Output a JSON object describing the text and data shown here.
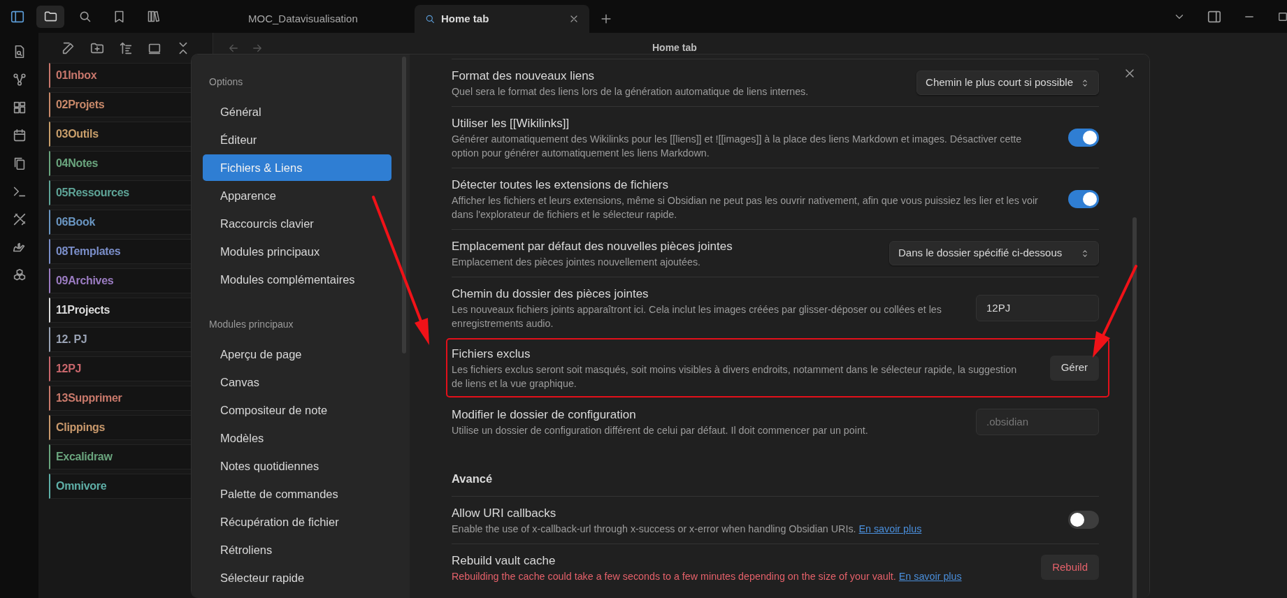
{
  "tabs": [
    {
      "label": "MOC_Datavisualisation",
      "selected": false
    },
    {
      "label": "Home tab",
      "selected": true
    }
  ],
  "view_header": {
    "title": "Home tab"
  },
  "file_explorer": {
    "folders": [
      {
        "name": "01Inbox",
        "color": "#c8776c"
      },
      {
        "name": "02Projets",
        "color": "#c9896a"
      },
      {
        "name": "03Outils",
        "color": "#c99f6b"
      },
      {
        "name": "04Notes",
        "color": "#6aa57e"
      },
      {
        "name": "05Ressources",
        "color": "#5fa598"
      },
      {
        "name": "06Book",
        "color": "#6a96c2"
      },
      {
        "name": "08Templates",
        "color": "#7b8fca"
      },
      {
        "name": "09Archives",
        "color": "#9b7cc2"
      },
      {
        "name": "11Projects",
        "color": "#dcdcdc"
      },
      {
        "name": "12. PJ",
        "color": "#9aa3b5"
      },
      {
        "name": "12PJ",
        "color": "#c9676c"
      },
      {
        "name": "13Supprimer",
        "color": "#c9796b"
      },
      {
        "name": "Clippings",
        "color": "#c9996c"
      },
      {
        "name": "Excalidraw",
        "color": "#6aa57e"
      },
      {
        "name": "Omnivore",
        "color": "#5fb0a8"
      }
    ]
  },
  "settings": {
    "nav": [
      {
        "heading": "Options",
        "items": [
          {
            "label": "Général",
            "selected": false
          },
          {
            "label": "Éditeur",
            "selected": false
          },
          {
            "label": "Fichiers & Liens",
            "selected": true
          },
          {
            "label": "Apparence",
            "selected": false
          },
          {
            "label": "Raccourcis clavier",
            "selected": false
          },
          {
            "label": "Modules principaux",
            "selected": false
          },
          {
            "label": "Modules complémentaires",
            "selected": false
          }
        ]
      },
      {
        "heading": "Modules principaux",
        "items": [
          {
            "label": "Aperçu de page",
            "selected": false
          },
          {
            "label": "Canvas",
            "selected": false
          },
          {
            "label": "Compositeur de note",
            "selected": false
          },
          {
            "label": "Modèles",
            "selected": false
          },
          {
            "label": "Notes quotidiennes",
            "selected": false
          },
          {
            "label": "Palette de commandes",
            "selected": false
          },
          {
            "label": "Récupération de fichier",
            "selected": false
          },
          {
            "label": "Rétroliens",
            "selected": false
          },
          {
            "label": "Sélecteur rapide",
            "selected": false
          }
        ]
      }
    ],
    "rows": [
      {
        "kind": "dropdown",
        "title": "Format des nouveaux liens",
        "description": "Quel sera le format des liens lors de la génération automatique de liens internes.",
        "value": "Chemin le plus court si possible",
        "highlighted": false,
        "warning": false
      },
      {
        "kind": "toggle",
        "title": "Utiliser les [[Wikilinks]]",
        "description": "Générer automatiquement des Wikilinks pour les [[liens]] et ![[images]] à la place des liens Markdown et images. Désactiver cette option pour générer automatiquement les liens Markdown.",
        "on": true,
        "highlighted": false,
        "warning": false
      },
      {
        "kind": "toggle",
        "title": "Détecter toutes les extensions de fichiers",
        "description": "Afficher les fichiers et leurs extensions, même si Obsidian ne peut pas les ouvrir nativement, afin que vous puissiez les lier et les voir dans l'explorateur de fichiers et le sélecteur rapide.",
        "on": true,
        "highlighted": false,
        "warning": false
      },
      {
        "kind": "dropdown",
        "title": "Emplacement par défaut des nouvelles pièces jointes",
        "description": "Emplacement des pièces jointes nouvellement ajoutées.",
        "value": "Dans le dossier spécifié ci-dessous",
        "highlighted": false,
        "warning": false
      },
      {
        "kind": "input",
        "title": "Chemin du dossier des pièces jointes",
        "description": "Les nouveaux fichiers joints apparaîtront ici. Cela inclut les images créées par glisser-déposer ou collées et les enregistrements audio.",
        "value": "12PJ",
        "highlighted": false,
        "warning": false
      },
      {
        "kind": "button",
        "title": "Fichiers exclus",
        "description": "Les fichiers exclus seront soit masqués, soit moins visibles à divers endroits, notamment dans le sélecteur rapide, la suggestion de liens et la vue graphique.",
        "button": "Gérer",
        "highlighted": true,
        "warning": false
      },
      {
        "kind": "input",
        "title": "Modifier le dossier de configuration",
        "description": "Utilise un dossier de configuration différent de celui par défaut. Il doit commencer par un point.",
        "placeholder": ".obsidian",
        "highlighted": false,
        "warning": false
      },
      {
        "kind": "heading",
        "title": "Avancé"
      },
      {
        "kind": "toggle",
        "title": "Allow URI callbacks",
        "description": "Enable the use of x-callback-url through x-success or x-error when handling Obsidian URIs.",
        "link": "En savoir plus",
        "on": false,
        "highlighted": false,
        "warning": false
      },
      {
        "kind": "button",
        "title": "Rebuild vault cache",
        "description": "Rebuilding the cache could take a few seconds to a few minutes depending on the size of your vault.",
        "link": "En savoir plus",
        "button": "Rebuild",
        "highlighted": false,
        "warning": true
      }
    ]
  }
}
